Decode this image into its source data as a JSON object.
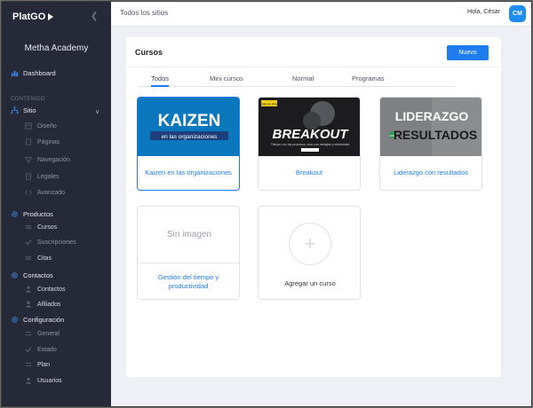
{
  "app": {
    "logo": "PlatGO",
    "academy": "Metha Academy"
  },
  "sidebar": {
    "dashboard": "Dashboard",
    "section_label": "CONTENIDO",
    "sitio": "Sitio",
    "sitio_items": [
      "Diseño",
      "Páginas",
      "Navegación",
      "Legales",
      "Avanzado"
    ],
    "productos": "Productos",
    "productos_items": [
      "Cursos",
      "Suscripciones",
      "Citas"
    ],
    "contactos": "Contactos",
    "contactos_items": [
      "Contactos",
      "Afiliados"
    ],
    "configuracion": "Configuración",
    "configuracion_items": [
      "General",
      "Estado",
      "Plan",
      "Usuarios"
    ]
  },
  "topbar": {
    "title": "Todos los sitios",
    "greeting": "Hola, César",
    "avatar": "CM"
  },
  "card": {
    "title": "Cursos",
    "new_label": "Nuevo",
    "tabs": [
      "Todos",
      "Mini cursos",
      "Normal",
      "Programas"
    ]
  },
  "courses": [
    {
      "name": "Kaizen en las organizaciones",
      "img_title": "KAIZEN",
      "img_sub": "en las organizaciones"
    },
    {
      "name": "Breakout",
      "img_title": "BREAKOUT",
      "img_badge": "Está en vivo!",
      "img_tagline": "Tiempo con los procesos, crea con ventajas y efectividad"
    },
    {
      "name": "Liderazgo con resultados",
      "img_title": "LIDERAZGO",
      "img_sub": "RESULTADOS",
      "img_con": "con"
    },
    {
      "name": "Gestión del tiempo y productividad",
      "no_image": "Sin imagen"
    },
    {
      "add_label": "Agregar un curso"
    }
  ],
  "colors": {
    "accent": "#1f7cf0",
    "sidebar_bg": "#262a38"
  }
}
